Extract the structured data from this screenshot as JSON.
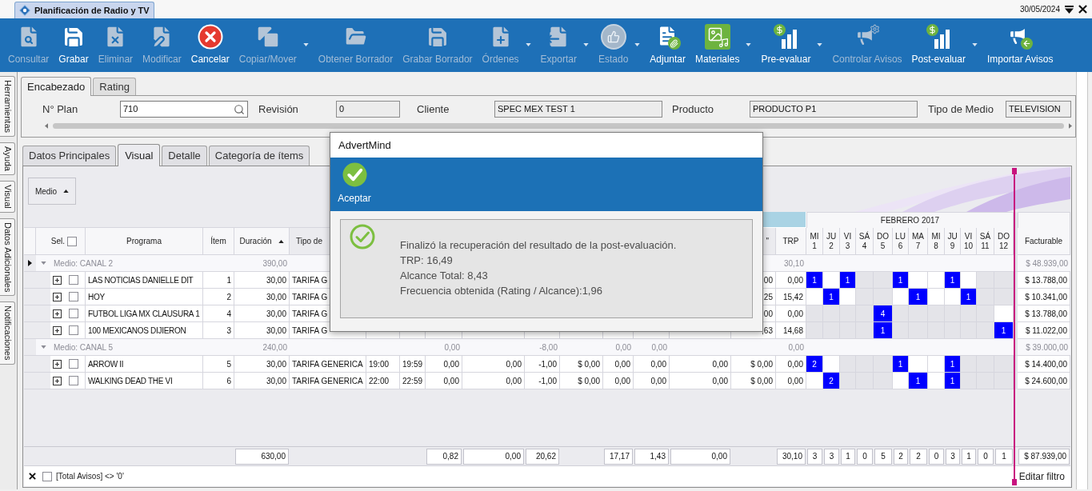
{
  "title_bar": {
    "tab": "Planificación de Radio y TV",
    "date": "30/05/2024"
  },
  "toolbar": [
    {
      "label": "Consultar",
      "disabled": true,
      "dropdown": false
    },
    {
      "label": "Grabar",
      "disabled": false,
      "dropdown": false
    },
    {
      "label": "Eliminar",
      "disabled": true,
      "dropdown": false
    },
    {
      "label": "Modificar",
      "disabled": true,
      "dropdown": false
    },
    {
      "label": "Cancelar",
      "disabled": false,
      "dropdown": false
    },
    {
      "label": "Copiar/Mover",
      "disabled": true,
      "dropdown": true
    },
    {
      "label": "Obtener Borrador",
      "disabled": true,
      "dropdown": false
    },
    {
      "label": "Grabar Borrador",
      "disabled": true,
      "dropdown": false
    },
    {
      "label": "Órdenes",
      "disabled": true,
      "dropdown": true
    },
    {
      "label": "Exportar",
      "disabled": true,
      "dropdown": true
    },
    {
      "label": "Estado",
      "disabled": true,
      "dropdown": true
    },
    {
      "label": "Adjuntar",
      "disabled": false,
      "dropdown": false
    },
    {
      "label": "Materiales",
      "disabled": false,
      "dropdown": true
    },
    {
      "label": "Pre-evaluar",
      "disabled": false,
      "dropdown": true
    },
    {
      "label": "Controlar Avisos",
      "disabled": true,
      "dropdown": false
    },
    {
      "label": "Post-evaluar",
      "disabled": false,
      "dropdown": true
    },
    {
      "label": "Importar Avisos",
      "disabled": false,
      "dropdown": false
    }
  ],
  "side_tabs": [
    "Herramientas",
    "Ayuda",
    "Visual",
    "Datos Adicionales",
    "Notificaciones"
  ],
  "header_tabs": [
    {
      "label": "Encabezado",
      "selected": true
    },
    {
      "label": "Rating",
      "selected": false
    }
  ],
  "header_fields": [
    {
      "label": "N° Plan",
      "value": "710",
      "readonly": false,
      "lookup": true
    },
    {
      "label": "Revisión",
      "value": "0",
      "readonly": true
    },
    {
      "label": "Cliente",
      "value": "SPEC MEX TEST 1",
      "readonly": true
    },
    {
      "label": "Producto",
      "value": "PRODUCTO P1",
      "readonly": true
    },
    {
      "label": "Tipo de Medio",
      "value": "TELEVISION",
      "readonly": true
    }
  ],
  "view_tabs": [
    {
      "label": "Datos Principales",
      "selected": false
    },
    {
      "label": "Visual",
      "selected": true
    },
    {
      "label": "Detalle",
      "selected": false
    },
    {
      "label": "Categoría de ítems",
      "selected": false
    }
  ],
  "group_by": {
    "label": "Medio",
    "ascending": true
  },
  "grid": {
    "month": "FEBRERO 2017",
    "headers": {
      "selection": {
        "label": "Sel.",
        "checked": false
      },
      "program": {
        "label": "Programa"
      },
      "item": {
        "label": "Ítem"
      },
      "duration": {
        "label": "Duración",
        "ascending": true
      },
      "type": {
        "label": "Tipo de"
      },
      "column_15": {
        "label": "\""
      },
      "trp": {
        "label": "TRP"
      },
      "billable": {
        "label": "Facturable"
      }
    },
    "days": [
      {
        "weekday": "MI",
        "day": "1"
      },
      {
        "weekday": "JU",
        "day": "2"
      },
      {
        "weekday": "VI",
        "day": "3"
      },
      {
        "weekday": "SÁ",
        "day": "4"
      },
      {
        "weekday": "DO",
        "day": "5"
      },
      {
        "weekday": "LU",
        "day": "6"
      },
      {
        "weekday": "MA",
        "day": "7"
      },
      {
        "weekday": "MI",
        "day": "8"
      },
      {
        "weekday": "JU",
        "day": "9"
      },
      {
        "weekday": "VI",
        "day": "10"
      },
      {
        "weekday": "SÁ",
        "day": "11"
      },
      {
        "weekday": "DO",
        "day": "12"
      }
    ],
    "groups": [
      {
        "label": "Medio: CANAL 2",
        "expanded": true,
        "focused": true,
        "totals": {
          "duration": "390,00",
          "trp": "30,10",
          "billable": "$ 48.939,00"
        },
        "rows": [
          {
            "expanded": false,
            "checked": false,
            "program": "LAS NOTICIAS DANIELLE DIT",
            "item": "1",
            "duration": "30,00",
            "type": "TARIFA G",
            "column_15": ",00",
            "trp": "0,00",
            "days": [
              {
                "kind": "spot",
                "spots": "1"
              },
              {
                "kind": "open"
              },
              {
                "kind": "spot",
                "spots": "1"
              },
              {
                "kind": "blocked"
              },
              {
                "kind": "blocked"
              },
              {
                "kind": "spot",
                "spots": "1"
              },
              {
                "kind": "open"
              },
              {
                "kind": "open"
              },
              {
                "kind": "spot",
                "spots": "1"
              },
              {
                "kind": "open"
              },
              {
                "kind": "blocked"
              },
              {
                "kind": "blocked"
              }
            ],
            "billable": "$ 13.788,00"
          },
          {
            "expanded": false,
            "checked": false,
            "program": "HOY",
            "item": "2",
            "duration": "30,00",
            "type": "TARIFA G",
            "column_15": ",25",
            "trp": "15,42",
            "days": [
              {
                "kind": "open"
              },
              {
                "kind": "spot",
                "spots": "1"
              },
              {
                "kind": "open"
              },
              {
                "kind": "blocked"
              },
              {
                "kind": "blocked"
              },
              {
                "kind": "open"
              },
              {
                "kind": "spot",
                "spots": "1"
              },
              {
                "kind": "open"
              },
              {
                "kind": "open"
              },
              {
                "kind": "spot",
                "spots": "1"
              },
              {
                "kind": "blocked"
              },
              {
                "kind": "blocked"
              }
            ],
            "billable": "$ 10.341,00"
          },
          {
            "expanded": false,
            "checked": false,
            "program": "FUTBOL LIGA MX CLAUSURA 1",
            "item": "4",
            "duration": "30,00",
            "type": "TARIFA G",
            "column_15": ",00",
            "trp": "0,00",
            "days": [
              {
                "kind": "blocked"
              },
              {
                "kind": "blocked"
              },
              {
                "kind": "blocked"
              },
              {
                "kind": "blocked"
              },
              {
                "kind": "spot",
                "spots": "4"
              },
              {
                "kind": "blocked"
              },
              {
                "kind": "blocked"
              },
              {
                "kind": "blocked"
              },
              {
                "kind": "blocked"
              },
              {
                "kind": "blocked"
              },
              {
                "kind": "blocked"
              },
              {
                "kind": "open"
              }
            ],
            "billable": "$ 13.788,00"
          },
          {
            "expanded": false,
            "checked": false,
            "program": "100 MEXICANOS DIJIERON",
            "item": "3",
            "duration": "30,00",
            "type": "TARIFA G",
            "column_15": ",63",
            "trp": "14,68",
            "days": [
              {
                "kind": "blocked"
              },
              {
                "kind": "blocked"
              },
              {
                "kind": "blocked"
              },
              {
                "kind": "blocked"
              },
              {
                "kind": "spot",
                "spots": "1"
              },
              {
                "kind": "blocked"
              },
              {
                "kind": "blocked"
              },
              {
                "kind": "blocked"
              },
              {
                "kind": "blocked"
              },
              {
                "kind": "blocked"
              },
              {
                "kind": "blocked"
              },
              {
                "kind": "spot",
                "spots": "1"
              }
            ],
            "billable": "$ 11.022,00"
          }
        ]
      },
      {
        "label": "Medio: CANAL 5",
        "expanded": true,
        "focused": false,
        "totals": {
          "duration": "240,00",
          "column_8": "0,00",
          "column_10": "-8,00",
          "column_12": "0,00",
          "column_13": "0,00",
          "trp": "0,00",
          "billable": "$ 39.000,00"
        },
        "rows": [
          {
            "expanded": false,
            "checked": false,
            "program": "ARROW II",
            "item": "5",
            "duration": "30,00",
            "type": "TARIFA GENERICA",
            "column_6": "19:00",
            "column_7": "19:59",
            "column_8": "0,00",
            "column_9": "0,00",
            "column_10": "-1,00",
            "column_11": "$ 0,00",
            "column_12": "0,00",
            "column_13": "0,00",
            "column_14": "0,00",
            "column_15": "$ 0,00",
            "trp": "0,00",
            "days": [
              {
                "kind": "spot",
                "spots": "2"
              },
              {
                "kind": "open"
              },
              {
                "kind": "blocked"
              },
              {
                "kind": "blocked"
              },
              {
                "kind": "blocked"
              },
              {
                "kind": "spot",
                "spots": "1"
              },
              {
                "kind": "open"
              },
              {
                "kind": "open"
              },
              {
                "kind": "spot",
                "spots": "1"
              },
              {
                "kind": "blocked"
              },
              {
                "kind": "blocked"
              },
              {
                "kind": "blocked"
              }
            ],
            "billable": "$ 14.400,00"
          },
          {
            "expanded": false,
            "checked": false,
            "program": "WALKING DEAD THE VI",
            "item": "6",
            "duration": "30,00",
            "type": "TARIFA GENERICA",
            "column_6": "22:00",
            "column_7": "22:59",
            "column_8": "0,00",
            "column_9": "0,00",
            "column_10": "-1,00",
            "column_11": "$ 0,00",
            "column_12": "0,00",
            "column_13": "0,00",
            "column_14": "0,00",
            "column_15": "$ 0,00",
            "trp": "0,00",
            "days": [
              {
                "kind": "open"
              },
              {
                "kind": "spot",
                "spots": "2"
              },
              {
                "kind": "blocked"
              },
              {
                "kind": "blocked"
              },
              {
                "kind": "blocked"
              },
              {
                "kind": "open"
              },
              {
                "kind": "spot",
                "spots": "1"
              },
              {
                "kind": "open"
              },
              {
                "kind": "spot",
                "spots": "1"
              },
              {
                "kind": "blocked"
              },
              {
                "kind": "blocked"
              },
              {
                "kind": "blocked"
              }
            ],
            "billable": "$ 24.600,00"
          }
        ]
      }
    ],
    "totals": {
      "duration": "630,00",
      "column_8": "0,82",
      "column_9": "0,00",
      "column_10": "20,62",
      "column_12": "17,17",
      "column_13": "1,43",
      "column_14": "0,00",
      "trp": "30,10",
      "days": [
        "3",
        "3",
        "1",
        "0",
        "5",
        "2",
        "2",
        "0",
        "3",
        "1",
        "0",
        "1"
      ],
      "billable": "$ 87.939,00"
    }
  },
  "filter": {
    "checked": false,
    "text": "[Total Avisos] <> '0'",
    "edit_link": "Editar filtro"
  },
  "dialog": {
    "title": "AdvertMind",
    "button": "Aceptar",
    "message": [
      "Finalizó la recuperación del resultado de la post-evaluación.",
      "TRP: 16,49",
      "Alcance Total: 8,43",
      "Frecuencia obtenida (Rating / Alcance):1,96"
    ]
  }
}
